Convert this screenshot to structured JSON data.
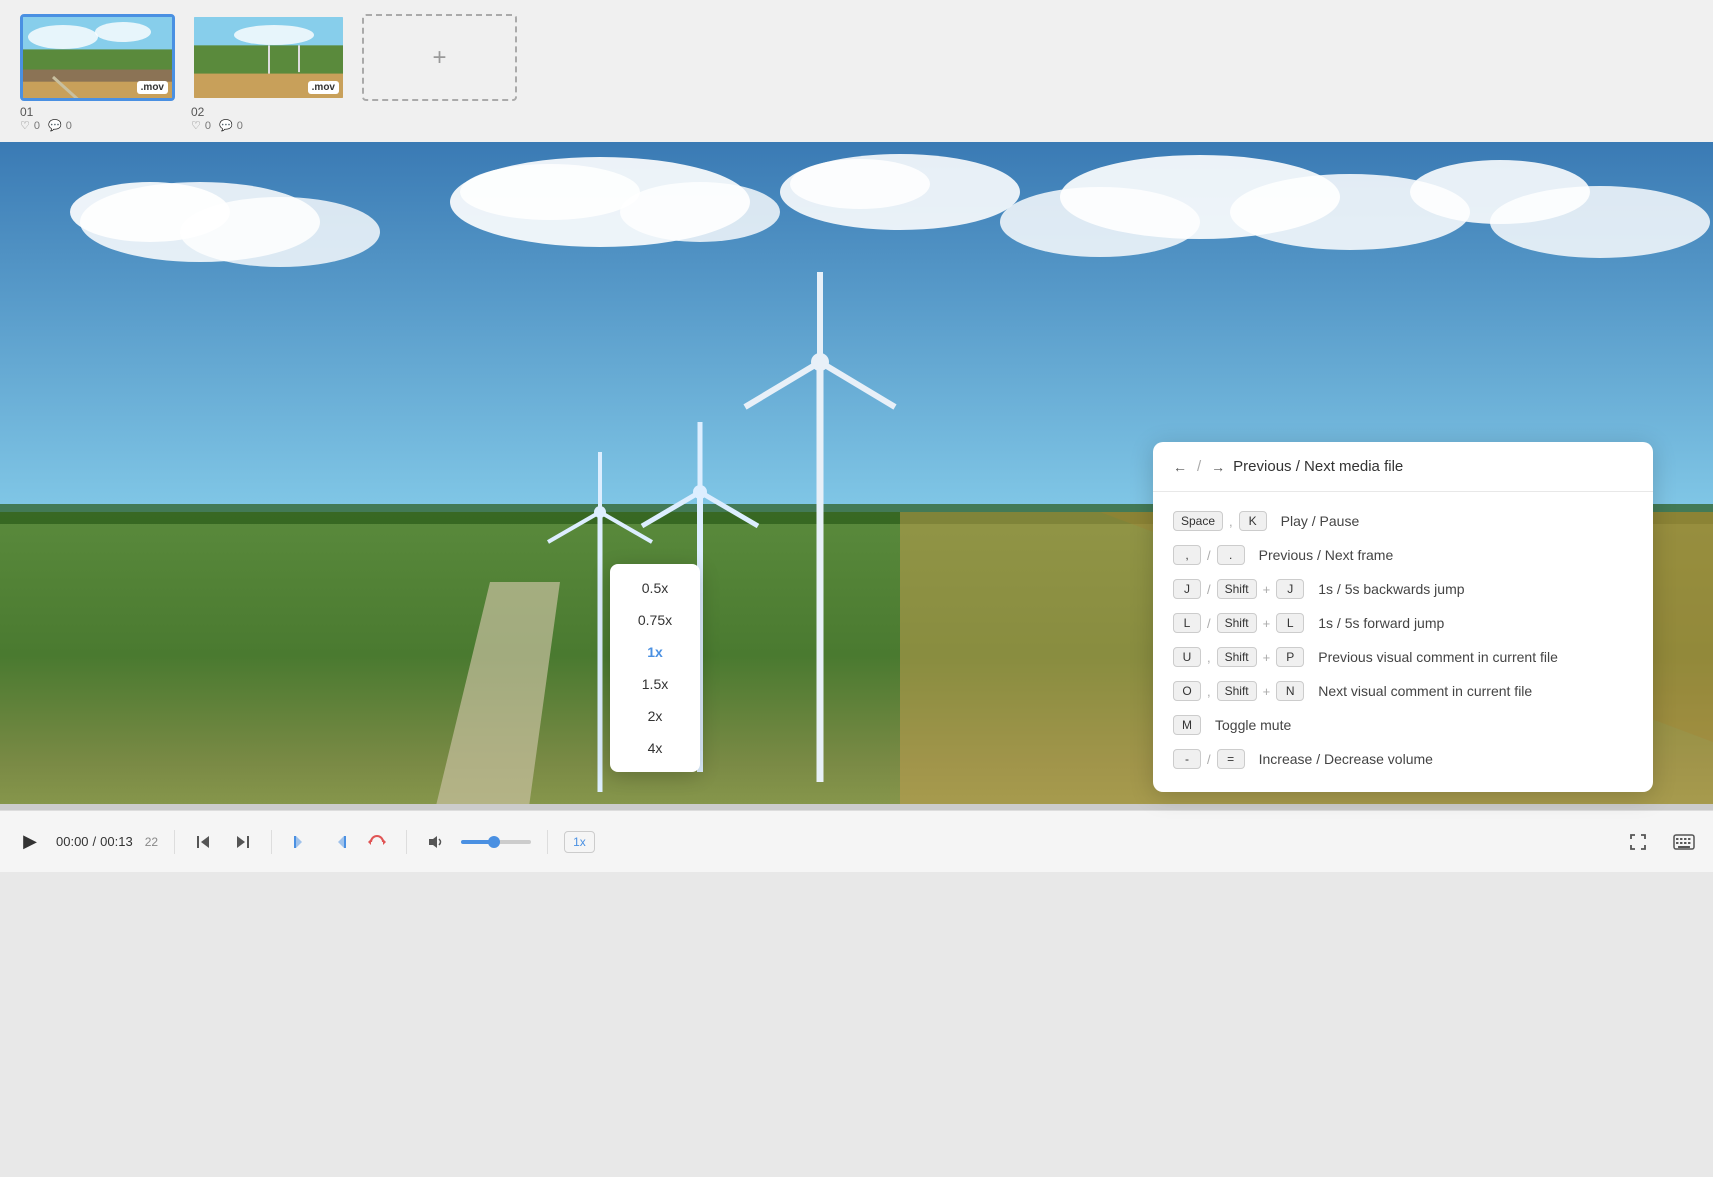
{
  "filmstrip": {
    "items": [
      {
        "id": "01",
        "label": "01",
        "badge": ".mov",
        "likes": "0",
        "comments": "0",
        "active": true
      },
      {
        "id": "02",
        "label": "02",
        "badge": ".mov",
        "likes": "0",
        "comments": "0",
        "active": false
      }
    ],
    "add_button_label": "+"
  },
  "speed_popup": {
    "options": [
      "0.5x",
      "0.75x",
      "1x",
      "1.5x",
      "2x",
      "4x"
    ],
    "active": "1x"
  },
  "shortcuts_popup": {
    "header": {
      "left_arrow": "←",
      "slash": "/",
      "right_arrow": "→",
      "description": "Previous / Next media file"
    },
    "shortcuts": [
      {
        "keys": [
          "Space",
          ",",
          "K"
        ],
        "separator": ",",
        "description": "Play / Pause"
      },
      {
        "keys": [
          ",",
          "/",
          "."
        ],
        "separator": "/",
        "description": "Previous / Next frame"
      },
      {
        "keys_complex": "J / Shift + J",
        "description": "1s / 5s backwards jump"
      },
      {
        "keys_complex": "L / Shift + L",
        "description": "1s / 5s forward jump"
      },
      {
        "keys_complex": "U , Shift + P",
        "description": "Previous visual comment in current file"
      },
      {
        "keys_complex": "O , Shift + N",
        "description": "Next visual comment in current file"
      },
      {
        "keys_complex": "M",
        "description": "Toggle mute"
      },
      {
        "keys_complex": "- / =",
        "description": "Increase / Decrease volume"
      }
    ]
  },
  "controls": {
    "time_current": "00:00",
    "time_total": "00:13",
    "frame": "22",
    "speed": "1x",
    "play_label": "▶"
  }
}
